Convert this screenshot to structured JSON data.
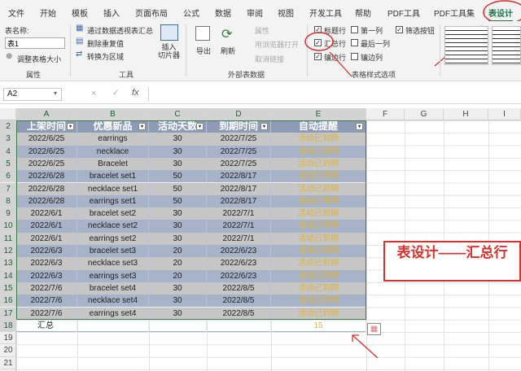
{
  "menu": [
    "文件",
    "开始",
    "模板",
    "插入",
    "页面布局",
    "公式",
    "数据",
    "审阅",
    "视图",
    "开发工具",
    "帮助",
    "PDF工具",
    "PDF工具集",
    "表设计"
  ],
  "props": {
    "name_label": "表名称:",
    "name_value": "表1",
    "resize": "调整表格大小",
    "group": "属性"
  },
  "tools": {
    "pivot": "通过数据透视表汇总",
    "remove_dup": "删除重复值",
    "convert": "转换为区域",
    "slicer": "插入\n切片器",
    "group": "工具"
  },
  "ext": {
    "export": "导出",
    "refresh": "刷新",
    "properties": "属性",
    "open_browser": "用浏览器打开",
    "unlink": "取消链接",
    "group": "外部表数据"
  },
  "style_opts": {
    "header_row": "标题行",
    "first_col": "第一列",
    "filter_btn": "筛选按钮",
    "total_row": "汇总行",
    "last_col": "最后一列",
    "banded_rows": "镶边行",
    "banded_cols": "镶边列",
    "group": "表格样式选项",
    "header_checked": true,
    "total_checked": true,
    "banded_checked": true,
    "filter_checked": true
  },
  "formula": {
    "cell_ref": "A2",
    "fx": "fx",
    "cancel": "×",
    "enter": "✓"
  },
  "columns": [
    "A",
    "B",
    "C",
    "D",
    "E",
    "F",
    "G",
    "H",
    "I"
  ],
  "rows": [
    "2",
    "3",
    "4",
    "5",
    "6",
    "7",
    "8",
    "9",
    "10",
    "11",
    "12",
    "13",
    "14",
    "15",
    "16",
    "17",
    "18",
    "19",
    "20",
    "21"
  ],
  "table": {
    "headers": [
      "上架时间",
      "优惠新品",
      "活动天数",
      "到期时间",
      "自动提醒"
    ],
    "data": [
      [
        "2022/6/25",
        "earrings",
        "30",
        "2022/7/25",
        "活动已到期"
      ],
      [
        "2022/6/25",
        "necklace",
        "30",
        "2022/7/25",
        "活动已到期"
      ],
      [
        "2022/6/25",
        "Bracelet",
        "30",
        "2022/7/25",
        "活动已到期"
      ],
      [
        "2022/6/28",
        "bracelet set1",
        "50",
        "2022/8/17",
        "活动已到期"
      ],
      [
        "2022/6/28",
        "necklace set1",
        "50",
        "2022/8/17",
        "活动已到期"
      ],
      [
        "2022/6/28",
        "earrings set1",
        "50",
        "2022/8/17",
        "活动已到期"
      ],
      [
        "2022/6/1",
        "bracelet set2",
        "30",
        "2022/7/1",
        "活动已到期"
      ],
      [
        "2022/6/1",
        "necklace set2",
        "30",
        "2022/7/1",
        "活动已到期"
      ],
      [
        "2022/6/1",
        "earrings set2",
        "30",
        "2022/7/1",
        "活动已到期"
      ],
      [
        "2022/6/3",
        "bracelet set3",
        "20",
        "2022/6/23",
        "活动已到期"
      ],
      [
        "2022/6/3",
        "necklace set3",
        "20",
        "2022/6/23",
        "活动已到期"
      ],
      [
        "2022/6/3",
        "earrings set3",
        "20",
        "2022/6/23",
        "活动已到期"
      ],
      [
        "2022/7/6",
        "bracelet set4",
        "30",
        "2022/8/5",
        "活动已到期"
      ],
      [
        "2022/7/6",
        "necklace set4",
        "30",
        "2022/8/5",
        "活动已到期"
      ],
      [
        "2022/7/6",
        "earrings set4",
        "30",
        "2022/8/5",
        "活动已到期"
      ]
    ],
    "total_label": "汇总",
    "total_value": "15"
  },
  "annotation": "表设计——汇总行",
  "colors": {
    "accent": "#217346",
    "annot": "#d9302c",
    "header": "#8e9bb6",
    "band_a": "#c6c6c6",
    "band_b": "#a7b3c8",
    "gold": "#d9b24a"
  }
}
